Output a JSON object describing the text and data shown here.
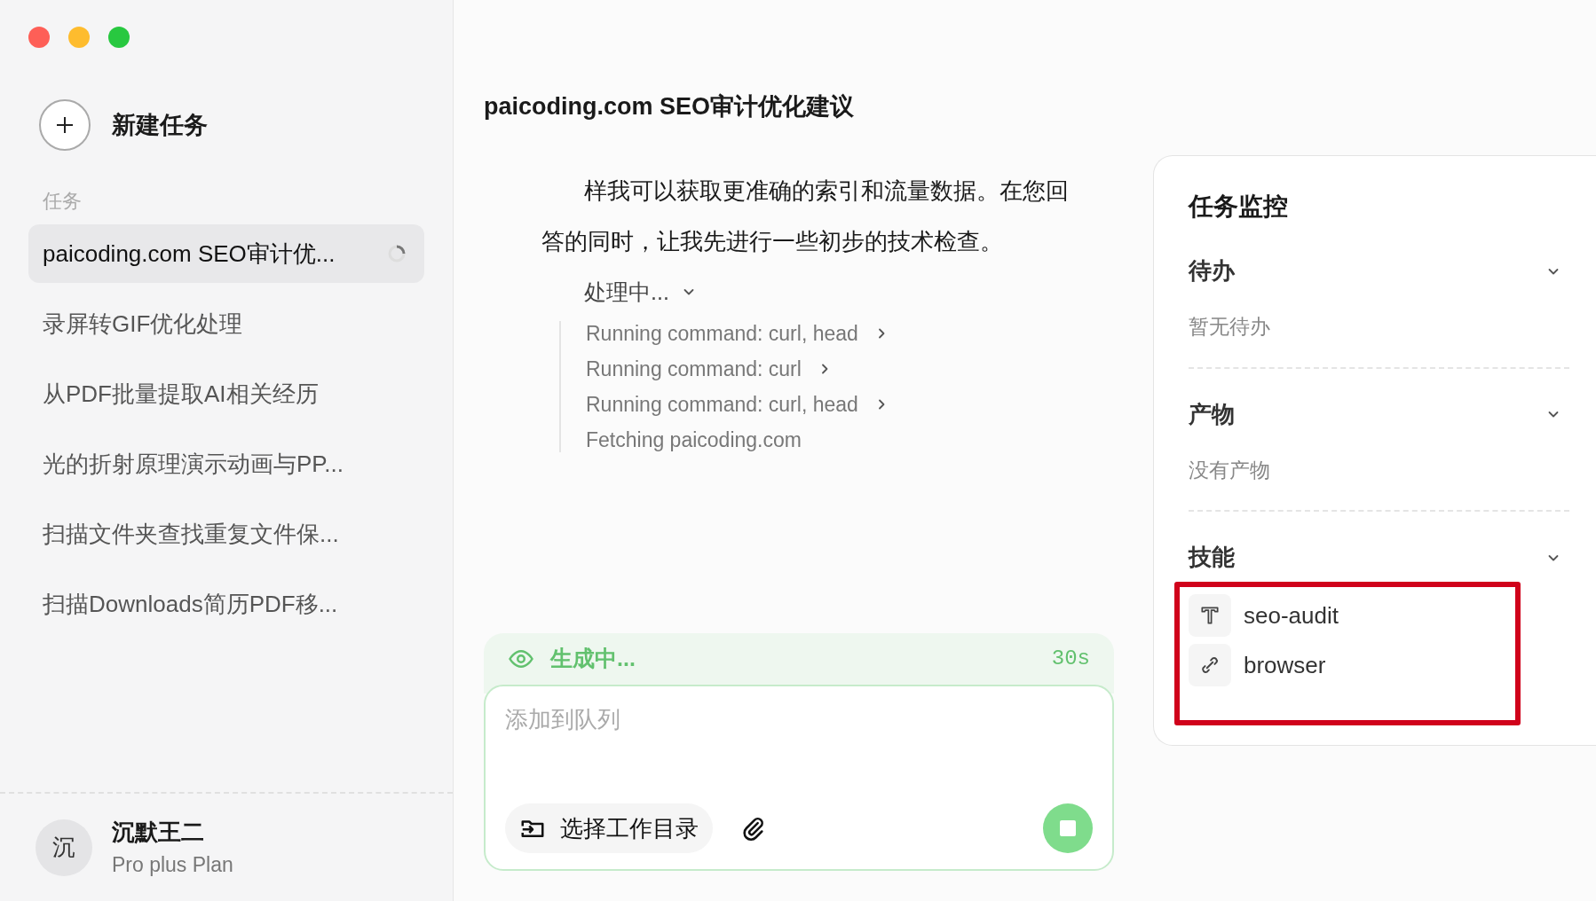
{
  "sidebar": {
    "new_task": "新建任务",
    "section_label": "任务",
    "tasks": [
      {
        "title": "paicoding.com SEO审计优...",
        "selected": true,
        "running": true
      },
      {
        "title": "录屏转GIF优化处理",
        "selected": false,
        "running": false
      },
      {
        "title": "从PDF批量提取AI相关经历",
        "selected": false,
        "running": false
      },
      {
        "title": "光的折射原理演示动画与PP...",
        "selected": false,
        "running": false
      },
      {
        "title": "扫描文件夹查找重复文件保...",
        "selected": false,
        "running": false
      },
      {
        "title": "扫描Downloads简历PDF移...",
        "selected": false,
        "running": false
      }
    ],
    "user": {
      "avatar": "沉",
      "name": "沉默王二",
      "plan": "Pro plus Plan"
    }
  },
  "chat": {
    "title": "paicoding.com SEO审计优化建议",
    "message": "样我可以获取更准确的索引和流量数据。在您回答的同时，让我先进行一些初步的技术检查。",
    "process": {
      "label": "处理中...",
      "steps": [
        {
          "text": "Running command: curl, head",
          "expandable": true
        },
        {
          "text": "Running command: curl",
          "expandable": true
        },
        {
          "text": "Running command: curl, head",
          "expandable": true
        },
        {
          "text": "Fetching paicoding.com",
          "expandable": false
        }
      ]
    },
    "status": {
      "label": "生成中...",
      "elapsed": "30s"
    },
    "composer": {
      "placeholder": "添加到队列",
      "folder_button": "选择工作目录"
    }
  },
  "monitor": {
    "title": "任务监控",
    "sections": [
      {
        "title": "待办",
        "empty": "暂无待办"
      },
      {
        "title": "产物",
        "empty": "没有产物"
      },
      {
        "title": "技能",
        "skills": [
          {
            "name": "seo-audit",
            "kind": "text"
          },
          {
            "name": "browser",
            "kind": "link"
          }
        ]
      }
    ]
  }
}
